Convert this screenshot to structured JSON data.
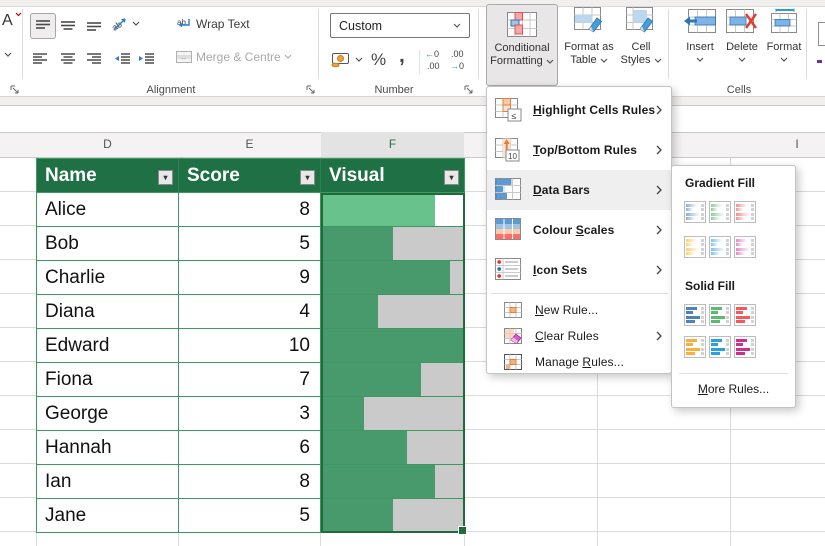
{
  "ribbon": {
    "font_letter": "A",
    "alignment": {
      "label": "Alignment",
      "wrap_text": "Wrap Text",
      "merge_centre": "Merge & Centre"
    },
    "number": {
      "label": "Number",
      "format_value": "Custom",
      "percent": "%",
      "comma": ","
    },
    "styles": {
      "conditional_line1": "Conditional",
      "conditional_line2": "Formatting",
      "format_table_line1": "Format as",
      "format_table_line2": "Table",
      "cell_styles_line1": "Cell",
      "cell_styles_line2": "Styles"
    },
    "cells": {
      "label": "Cells",
      "insert": "Insert",
      "delete": "Delete",
      "format": "Format"
    }
  },
  "menu": {
    "items": [
      {
        "label": "Highlight Cells Rules",
        "key_index": 0
      },
      {
        "label": "Top/Bottom Rules",
        "key_index": 0
      },
      {
        "label": "Data Bars",
        "key_index": 0
      },
      {
        "label": "Colour Scales",
        "key_index": 7
      },
      {
        "label": "Icon Sets",
        "key_index": 0
      }
    ],
    "footer": [
      {
        "label": "New Rule...",
        "key_index": 0
      },
      {
        "label": "Clear Rules",
        "key_index": 0
      },
      {
        "label": "Manage Rules...",
        "key_index": 7
      }
    ]
  },
  "submenu": {
    "gradient_title": "Gradient Fill",
    "solid_title": "Solid Fill",
    "more_rules": "More Rules...",
    "more_rules_key_index": 0,
    "gradient_colors": [
      "#85AEDC",
      "#8CCE9C",
      "#F2918C",
      "#FFD166",
      "#79C2EA",
      "#E687C3"
    ],
    "solid_colors": [
      "#4F81BD",
      "#5DB96D",
      "#F25B5B",
      "#FBAE3D",
      "#26A2E3",
      "#D12D8C"
    ]
  },
  "sheet": {
    "column_letters": [
      "D",
      "E",
      "F"
    ],
    "right_column_letter": "I",
    "selected_column": "F",
    "table": {
      "headers": [
        "Name",
        "Score",
        "Visual"
      ],
      "max_score": 10,
      "rows": [
        {
          "name": "Alice",
          "score": 8,
          "active": true
        },
        {
          "name": "Bob",
          "score": 5
        },
        {
          "name": "Charlie",
          "score": 9
        },
        {
          "name": "Diana",
          "score": 4
        },
        {
          "name": "Edward",
          "score": 10
        },
        {
          "name": "Fiona",
          "score": 7
        },
        {
          "name": "George",
          "score": 3
        },
        {
          "name": "Hannah",
          "score": 6
        },
        {
          "name": "Ian",
          "score": 8
        },
        {
          "name": "Jane",
          "score": 5
        }
      ]
    }
  },
  "colors": {
    "header_green": "#1F7145",
    "table_border": "#3E9862",
    "selection_border": "#1D6B3B",
    "bar": "#489A6C",
    "bar_active": "#67C28B",
    "track": "#CACACA",
    "accent_blue": "#2B7CD3"
  }
}
